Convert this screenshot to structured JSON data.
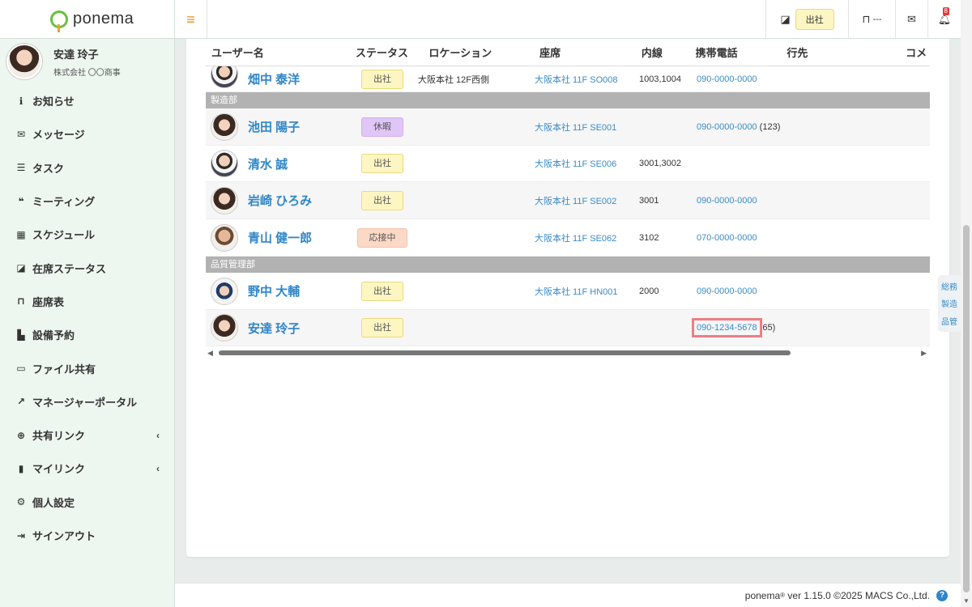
{
  "app": {
    "logo_text": "ponema"
  },
  "profile": {
    "name": "安達 玲子",
    "company": "株式会社 〇〇商事"
  },
  "menu": [
    {
      "label": "お知らせ",
      "icon": "info-icon"
    },
    {
      "label": "メッセージ",
      "icon": "mail-icon"
    },
    {
      "label": "タスク",
      "icon": "task-list-icon"
    },
    {
      "label": "ミーティング",
      "icon": "chat-icon"
    },
    {
      "label": "スケジュール",
      "icon": "calendar-icon"
    },
    {
      "label": "在席ステータス",
      "icon": "presence-icon"
    },
    {
      "label": "座席表",
      "icon": "chair-icon"
    },
    {
      "label": "設備予約",
      "icon": "facility-icon"
    },
    {
      "label": "ファイル共有",
      "icon": "folder-icon"
    },
    {
      "label": "マネージャーポータル",
      "icon": "chart-icon"
    },
    {
      "label": "共有リンク",
      "icon": "globe-icon"
    },
    {
      "label": "マイリンク",
      "icon": "bookmark-icon"
    },
    {
      "label": "個人設定",
      "icon": "gear-icon"
    },
    {
      "label": "サインアウト",
      "icon": "signout-icon"
    }
  ],
  "topbar": {
    "status": "出社",
    "seat": "---",
    "notification_count": "8"
  },
  "table": {
    "headers": {
      "name": "ユーザー名",
      "status": "ステータス",
      "location": "ロケーション",
      "seat": "座席",
      "extension": "内線",
      "mobile": "携帯電話",
      "destination": "行先",
      "comment": "コメ"
    },
    "first_row": {
      "name": "畑中 泰洋",
      "status": "出社",
      "location": "大阪本社 12F西側",
      "seat": "大阪本社 11F SO008",
      "extension": "1003,1004",
      "mobile": "090-0000-0000"
    },
    "groups": [
      {
        "name": "製造部",
        "rows": [
          {
            "name": "池田 陽子",
            "status": "休暇",
            "location": "",
            "seat": "大阪本社 11F SE001",
            "extension": "",
            "mobile": "090-0000-0000",
            "mobile_suffix": " (123)"
          },
          {
            "name": "清水 誠",
            "status": "出社",
            "location": "",
            "seat": "大阪本社 11F SE006",
            "extension": "3001,3002",
            "mobile": ""
          },
          {
            "name": "岩崎 ひろみ",
            "status": "出社",
            "location": "",
            "seat": "大阪本社 11F SE002",
            "extension": "3001",
            "mobile": "090-0000-0000"
          },
          {
            "name": "青山 健一郎",
            "status": "応接中",
            "location": "",
            "seat": "大阪本社 11F SE062",
            "extension": "3102",
            "mobile": "070-0000-0000"
          }
        ]
      },
      {
        "name": "品質管理部",
        "rows": [
          {
            "name": "野中 大輔",
            "status": "出社",
            "location": "",
            "seat": "大阪本社 11F HN001",
            "extension": "2000",
            "mobile": "090-0000-0000"
          },
          {
            "name": "安達 玲子",
            "status": "出社",
            "location": "",
            "seat": "",
            "extension": "",
            "mobile": "090-1234-5678",
            "mobile_suffix": " (65)"
          }
        ]
      }
    ]
  },
  "quicknav": [
    "総務",
    "製造",
    "品管"
  ],
  "footer": {
    "product": "ponema",
    "reg": "®",
    "version_text": " ver 1.15.0 ©2025 MACS Co.,Ltd.",
    "help": "?"
  }
}
